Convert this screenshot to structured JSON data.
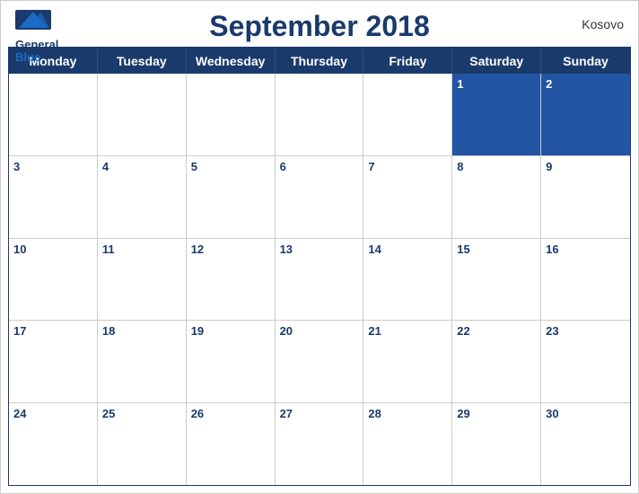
{
  "header": {
    "title": "September 2018",
    "country": "Kosovo",
    "logo_general": "General",
    "logo_blue": "Blue"
  },
  "days_of_week": [
    "Monday",
    "Tuesday",
    "Wednesday",
    "Thursday",
    "Friday",
    "Saturday",
    "Sunday"
  ],
  "weeks": [
    [
      {
        "num": "",
        "empty": true
      },
      {
        "num": "",
        "empty": true
      },
      {
        "num": "",
        "empty": true
      },
      {
        "num": "",
        "empty": true
      },
      {
        "num": "",
        "empty": true
      },
      {
        "num": "1",
        "empty": false
      },
      {
        "num": "2",
        "empty": false
      }
    ],
    [
      {
        "num": "3",
        "empty": false
      },
      {
        "num": "4",
        "empty": false
      },
      {
        "num": "5",
        "empty": false
      },
      {
        "num": "6",
        "empty": false
      },
      {
        "num": "7",
        "empty": false
      },
      {
        "num": "8",
        "empty": false
      },
      {
        "num": "9",
        "empty": false
      }
    ],
    [
      {
        "num": "10",
        "empty": false
      },
      {
        "num": "11",
        "empty": false
      },
      {
        "num": "12",
        "empty": false
      },
      {
        "num": "13",
        "empty": false
      },
      {
        "num": "14",
        "empty": false
      },
      {
        "num": "15",
        "empty": false
      },
      {
        "num": "16",
        "empty": false
      }
    ],
    [
      {
        "num": "17",
        "empty": false
      },
      {
        "num": "18",
        "empty": false
      },
      {
        "num": "19",
        "empty": false
      },
      {
        "num": "20",
        "empty": false
      },
      {
        "num": "21",
        "empty": false
      },
      {
        "num": "22",
        "empty": false
      },
      {
        "num": "23",
        "empty": false
      }
    ],
    [
      {
        "num": "24",
        "empty": false
      },
      {
        "num": "25",
        "empty": false
      },
      {
        "num": "26",
        "empty": false
      },
      {
        "num": "27",
        "empty": false
      },
      {
        "num": "28",
        "empty": false
      },
      {
        "num": "29",
        "empty": false
      },
      {
        "num": "30",
        "empty": false
      }
    ]
  ],
  "colors": {
    "header_bg": "#1a3a6b",
    "header_row_bg": "#2255a4",
    "accent": "#1a6bc4"
  }
}
